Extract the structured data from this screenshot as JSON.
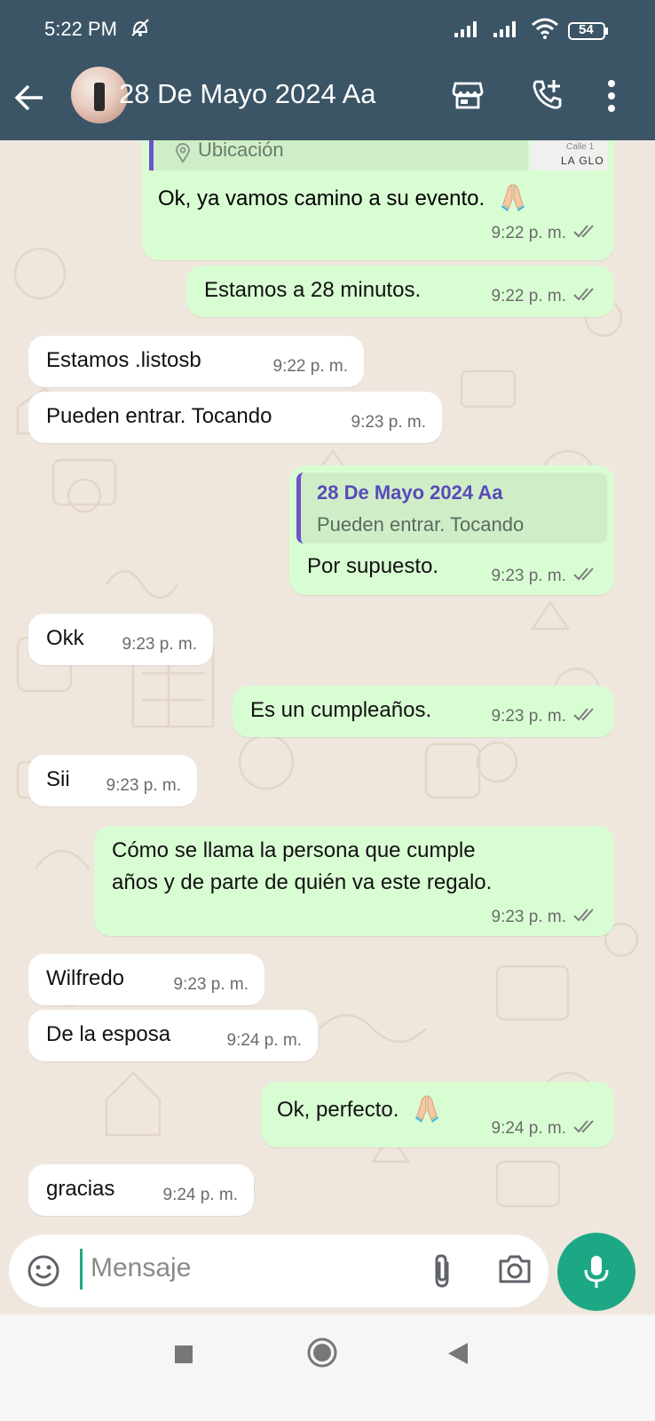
{
  "status_bar": {
    "time": "5:22 PM",
    "battery": "54"
  },
  "header": {
    "title": "28 De Mayo 2024 Aa"
  },
  "location_preview": {
    "label": "Ubicación",
    "map_street": "Calle 1",
    "map_label": "LA GLO"
  },
  "messages": [
    {
      "dir": "out",
      "text": "Ok, ya vamos camino a su evento.",
      "emoji": "folded-hands",
      "time": "9:22 p. m."
    },
    {
      "dir": "out",
      "text": "Estamos a 28 minutos.",
      "time": "9:22 p. m."
    },
    {
      "dir": "in",
      "text": "Estamos .listosb",
      "time": "9:22 p. m."
    },
    {
      "dir": "in",
      "text": "Pueden entrar. Tocando",
      "time": "9:23 p. m."
    },
    {
      "dir": "out",
      "text": "Por supuesto.",
      "time": "9:23 p. m.",
      "quote": {
        "name": "28 De Mayo 2024 Aa",
        "text": "Pueden entrar. Tocando"
      }
    },
    {
      "dir": "in",
      "text": "Okk",
      "time": "9:23 p. m."
    },
    {
      "dir": "out",
      "text": "Es un cumpleaños.",
      "time": "9:23 p. m."
    },
    {
      "dir": "in",
      "text": "Sii",
      "time": "9:23 p. m."
    },
    {
      "dir": "out",
      "text_line1": "Cómo se llama la persona que cumple",
      "text_line2": "años y de parte de quién va este regalo.",
      "time": "9:23 p. m."
    },
    {
      "dir": "in",
      "text": "Wilfredo",
      "time": "9:23 p. m."
    },
    {
      "dir": "in",
      "text": "De la esposa",
      "time": "9:24 p. m."
    },
    {
      "dir": "out",
      "text": "Ok, perfecto.",
      "emoji": "folded-hands",
      "time": "9:24 p. m."
    },
    {
      "dir": "in",
      "text": "gracias",
      "time": "9:24 p. m."
    }
  ],
  "composer": {
    "placeholder": "Mensaje"
  },
  "colors": {
    "header_bg": "#3b5566",
    "outgoing_bubble": "#d9fdd3",
    "incoming_bubble": "#ffffff",
    "chat_bg": "#efe7de",
    "accent": "#1da885",
    "read_ticks": "#6b6b6b"
  },
  "icons": [
    "back-arrow-icon",
    "store-icon",
    "add-call-icon",
    "more-vert-icon",
    "emoji-icon",
    "attach-icon",
    "camera-icon",
    "mic-icon",
    "double-check-icon",
    "location-pin-icon"
  ]
}
